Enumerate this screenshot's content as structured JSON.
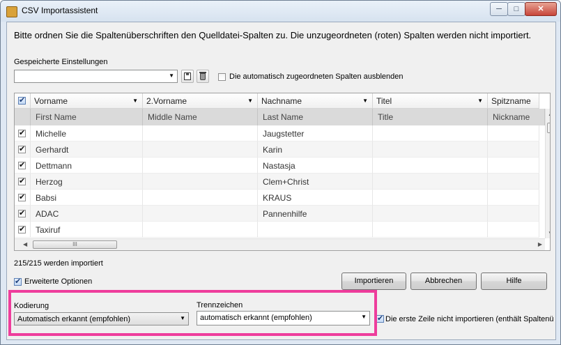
{
  "window": {
    "title": "CSV Importassistent",
    "minimize": "─",
    "maximize": "□",
    "close": "✕"
  },
  "instructions": "Bitte ordnen Sie die Spaltenüberschriften den Quelldatei-Spalten zu. Die unzugeordneten (roten) Spalten werden nicht importiert.",
  "saved_settings": {
    "label": "Gespeicherte Einstellungen",
    "value": "",
    "save_icon": "floppy-disk-icon",
    "delete_icon": "trash-icon",
    "hide_checkbox_label": "Die automatisch zugeordneten Spalten ausblenden",
    "hide_checkbox_checked": false
  },
  "table": {
    "columns": [
      {
        "header": "Vorname",
        "source": "First Name"
      },
      {
        "header": "2.Vorname",
        "source": "Middle Name"
      },
      {
        "header": "Nachname",
        "source": "Last Name"
      },
      {
        "header": "Titel",
        "source": "Title"
      },
      {
        "header": "Spitzname",
        "source": "Nickname"
      }
    ],
    "rows": [
      {
        "checked": true,
        "cells": [
          "Michelle",
          "",
          "Jaugstetter",
          "",
          ""
        ]
      },
      {
        "checked": true,
        "cells": [
          "Gerhardt",
          "",
          "Karin",
          "",
          ""
        ]
      },
      {
        "checked": true,
        "cells": [
          "Dettmann",
          "",
          "Nastasja",
          "",
          ""
        ]
      },
      {
        "checked": true,
        "cells": [
          "Herzog",
          "",
          "Clem+Christ",
          "",
          ""
        ]
      },
      {
        "checked": true,
        "cells": [
          "Babsi",
          "",
          "KRAUS",
          "",
          ""
        ]
      },
      {
        "checked": true,
        "cells": [
          "ADAC",
          "",
          "Pannenhilfe",
          "",
          ""
        ]
      },
      {
        "checked": true,
        "cells": [
          "Taxiruf",
          "",
          "",
          "",
          ""
        ]
      }
    ],
    "scroll_grip": "III"
  },
  "status": "215/215 werden importiert",
  "advanced_options": {
    "label": "Erweiterte Optionen",
    "checked": true
  },
  "buttons": {
    "import": "Importieren",
    "cancel": "Abbrechen",
    "help": "Hilfe"
  },
  "encoding": {
    "label": "Kodierung",
    "value": "Automatisch erkannt (empfohlen)"
  },
  "separator": {
    "label": "Trennzeichen",
    "value": "automatisch erkannt (empfohlen)"
  },
  "skip_first_row": {
    "label": "Die erste Zeile nicht importieren (enthält Spaltenü",
    "checked": true
  },
  "colors": {
    "highlight": "#ee3d9c",
    "row_alt": "#f5f5f5",
    "subheader": "#dadada"
  }
}
